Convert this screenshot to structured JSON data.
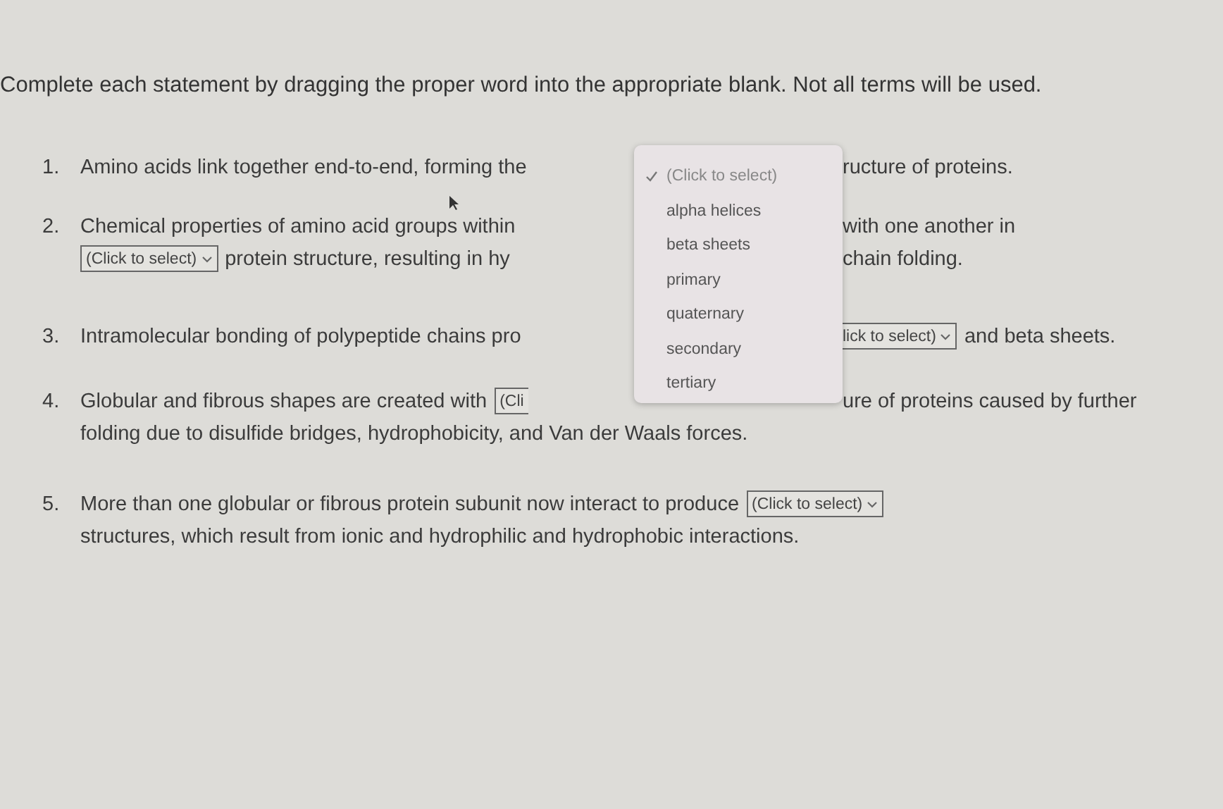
{
  "instructions": "Complete each statement by dragging the proper word into the appropriate blank. Not all terms will be used.",
  "statements": [
    {
      "number": "1.",
      "lines": [
        {
          "before": [
            {
              "kind": "text",
              "text": "Amino acids link together end-to-end, forming the"
            }
          ],
          "after": [
            {
              "kind": "text",
              "text": "ructure of proteins."
            }
          ]
        }
      ]
    },
    {
      "number": "2.",
      "lines": [
        {
          "before": [
            {
              "kind": "text",
              "text": "Chemical properties of amino acid groups within"
            }
          ],
          "after": [
            {
              "kind": "text",
              "text": "with one another in"
            }
          ]
        },
        {
          "before": [
            {
              "kind": "select",
              "text": "(Click to select)"
            },
            {
              "kind": "text",
              "text": "protein structure, resulting in hy"
            }
          ],
          "after": [
            {
              "kind": "text",
              "text": "chain folding."
            }
          ]
        }
      ]
    },
    {
      "number": "3.",
      "lines": [
        {
          "before": [
            {
              "kind": "text",
              "text": "Intramolecular bonding of polypeptide chains pro"
            }
          ],
          "after": [
            {
              "kind": "select-end",
              "text": "lick to select)"
            },
            {
              "kind": "text",
              "text": "and beta sheets."
            }
          ]
        }
      ]
    },
    {
      "number": "4.",
      "lines": [
        {
          "before": [
            {
              "kind": "text",
              "text": "Globular and fibrous shapes are created with"
            },
            {
              "kind": "select-start",
              "text": "(Cli"
            }
          ],
          "after": [
            {
              "kind": "text",
              "text": "ure of proteins caused by further"
            }
          ]
        },
        {
          "before": [
            {
              "kind": "text",
              "text": "folding due to disulfide bridges, hydrophobicity, and Van der Waals forces."
            }
          ]
        }
      ]
    },
    {
      "number": "5.",
      "lines": [
        {
          "before": [
            {
              "kind": "text",
              "text": "More than one globular or fibrous protein subunit now interact to produce"
            },
            {
              "kind": "select",
              "text": "(Click to select)"
            }
          ]
        },
        {
          "before": [
            {
              "kind": "text",
              "text": "structures, which result from ionic and hydrophilic and hydrophobic interactions."
            }
          ]
        }
      ]
    }
  ],
  "menu": {
    "options": [
      {
        "label": "(Click to select)",
        "selected": true
      },
      {
        "label": "alpha helices",
        "selected": false
      },
      {
        "label": "beta sheets",
        "selected": false
      },
      {
        "label": "primary",
        "selected": false
      },
      {
        "label": "quaternary",
        "selected": false
      },
      {
        "label": "secondary",
        "selected": false
      },
      {
        "label": "tertiary",
        "selected": false
      }
    ]
  }
}
